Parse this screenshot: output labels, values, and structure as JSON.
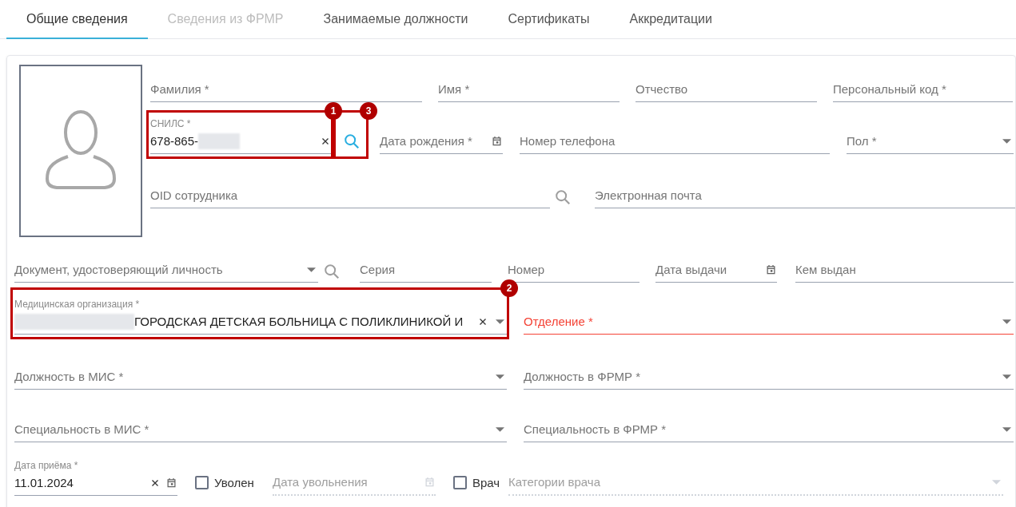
{
  "tabs": [
    {
      "label": "Общие сведения",
      "selected": true
    },
    {
      "label": "Сведения из ФРМР",
      "selected": false,
      "disabled": true
    },
    {
      "label": "Занимаемые должности",
      "selected": false
    },
    {
      "label": "Сертификаты",
      "selected": false
    },
    {
      "label": "Аккредитации",
      "selected": false
    }
  ],
  "form": {
    "beside_photo_rows": [
      {
        "fields": [
          {
            "kind": "text",
            "label": "Фамилия *"
          },
          {
            "kind": "text",
            "label": "Имя *"
          },
          {
            "kind": "text",
            "label": "Отчество"
          },
          {
            "kind": "text",
            "label": "Персональный код *"
          }
        ]
      },
      {
        "fields": [
          {
            "kind": "text",
            "label": "СНИЛС *",
            "value": "678-865-",
            "redacted_end": true,
            "clearable": true,
            "callout": "1"
          },
          {
            "kind": "search_button",
            "callout": "3"
          },
          {
            "kind": "date",
            "label": "Дата рождения *"
          },
          {
            "kind": "text",
            "label": "Номер телефона"
          },
          {
            "kind": "select",
            "label": "Пол *"
          }
        ]
      },
      {
        "fields": [
          {
            "kind": "text",
            "label": "OID сотрудника"
          },
          {
            "kind": "search_icon"
          },
          {
            "kind": "text",
            "label": "Электронная почта"
          }
        ]
      }
    ],
    "rows": [
      {
        "fields": [
          {
            "kind": "select",
            "label": "Документ, удостоверяющий личность"
          },
          {
            "kind": "search_icon"
          },
          {
            "kind": "text",
            "label": "Серия"
          },
          {
            "kind": "text",
            "label": "Номер"
          },
          {
            "kind": "date",
            "label": "Дата выдачи"
          },
          {
            "kind": "text",
            "label": "Кем выдан"
          }
        ]
      },
      {
        "fields": [
          {
            "kind": "select",
            "label": "Медицинская организация *",
            "value": "ГОРОДСКАЯ ДЕТСКАЯ БОЛЬНИЦА С ПОЛИКЛИНИКОЙ И",
            "redacted_start": true,
            "clearable": true,
            "callout": "2"
          },
          {
            "kind": "select",
            "label": "Отделение *",
            "error": true
          }
        ]
      },
      {
        "fields": [
          {
            "kind": "select",
            "label": "Должность в МИС *"
          },
          {
            "kind": "select",
            "label": "Должность в ФРМР *"
          }
        ]
      },
      {
        "fields": [
          {
            "kind": "select",
            "label": "Специальность в МИС *"
          },
          {
            "kind": "select",
            "label": "Специальность в ФРМР *"
          }
        ]
      },
      {
        "fields": [
          {
            "kind": "date",
            "label": "Дата приёма *",
            "value": "11.01.2024",
            "clearable": true
          },
          {
            "kind": "checkbox",
            "label": "Уволен",
            "checked": false
          },
          {
            "kind": "date",
            "label": "Дата увольнения",
            "disabled": true
          },
          {
            "kind": "checkbox",
            "label": "Врач",
            "checked": false
          },
          {
            "kind": "select",
            "label": "Категории врача",
            "disabled": true
          }
        ]
      }
    ]
  }
}
